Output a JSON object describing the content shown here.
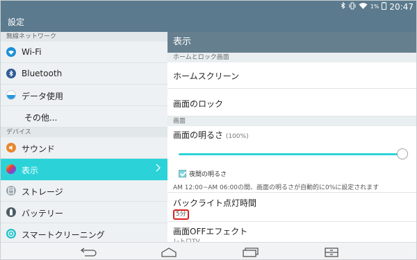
{
  "statusbar": {
    "battery_pct": "1%",
    "time": "20:47"
  },
  "app": {
    "title": "設定"
  },
  "sidebar": {
    "sections": [
      {
        "header": "無線ネットワーク",
        "items": [
          {
            "label": "Wi-Fi",
            "icon": "wifi-icon"
          },
          {
            "label": "Bluetooth",
            "icon": "bluetooth-icon"
          },
          {
            "label": "データ使用",
            "icon": "data-usage-icon"
          },
          {
            "label": "その他...",
            "icon": ""
          }
        ]
      },
      {
        "header": "デバイス",
        "items": [
          {
            "label": "サウンド",
            "icon": "sound-icon"
          },
          {
            "label": "表示",
            "icon": "display-icon",
            "selected": true
          },
          {
            "label": "ストレージ",
            "icon": "storage-icon"
          },
          {
            "label": "バッテリー",
            "icon": "battery-icon"
          },
          {
            "label": "スマートクリーニング",
            "icon": "smart-cleaning-icon"
          }
        ]
      }
    ]
  },
  "detail": {
    "title": "表示",
    "sec_home_lock": "ホームとロック画面",
    "home_screen": "ホームスクリーン",
    "screen_lock": "画面のロック",
    "sec_screen": "画面",
    "brightness_label": "画面の明るさ",
    "brightness_value": "(100%)",
    "brightness_level": 1.0,
    "night_brightness_label": "夜間の明るさ",
    "night_brightness_checked": true,
    "night_note": "AM 12:00~AM 06:00の間、画面の明るさが自動的に0%に設定されます",
    "backlight_label": "バックライト点灯時間",
    "backlight_value": "5分",
    "screen_off_label": "画面OFFエフェクト",
    "screen_off_value": "レトロTV"
  },
  "colors": {
    "bar": "#5b7a8d",
    "accent": "#2bd3d8",
    "highlight": "#d9201d"
  }
}
